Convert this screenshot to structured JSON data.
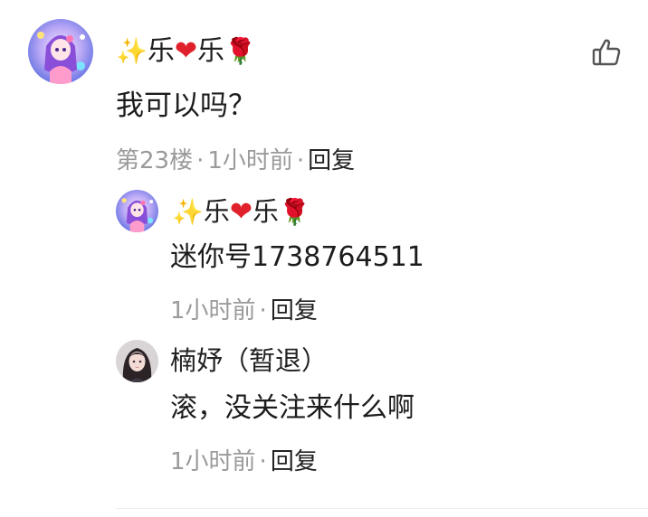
{
  "main_comment": {
    "user": {
      "name_prefix": "✨",
      "name_part1": "乐",
      "name_heart": "❤",
      "name_part2": "乐",
      "name_suffix": "🌹"
    },
    "text": "我可以吗？",
    "floor": "第23楼",
    "time": "1小时前",
    "reply_label": "回复",
    "separator": "·"
  },
  "replies": [
    {
      "user": {
        "name_prefix": "✨",
        "name_part1": "乐",
        "name_heart": "❤",
        "name_part2": "乐",
        "name_suffix": "🌹"
      },
      "text": "迷你号1738764511",
      "time": "1小时前",
      "reply_label": "回复",
      "separator": "·"
    },
    {
      "user": {
        "name": "楠妤（暂退）"
      },
      "text": "滚，没关注来什么啊",
      "time": "1小时前",
      "reply_label": "回复",
      "separator": "·"
    }
  ],
  "icons": {
    "like": "thumbs-up-icon",
    "avatar_main": "anime-avatar-purple",
    "avatar_reply2": "anime-avatar-dark-hair"
  },
  "colors": {
    "text": "#222222",
    "meta": "#9a9a9a",
    "heart": "#e0212b"
  }
}
